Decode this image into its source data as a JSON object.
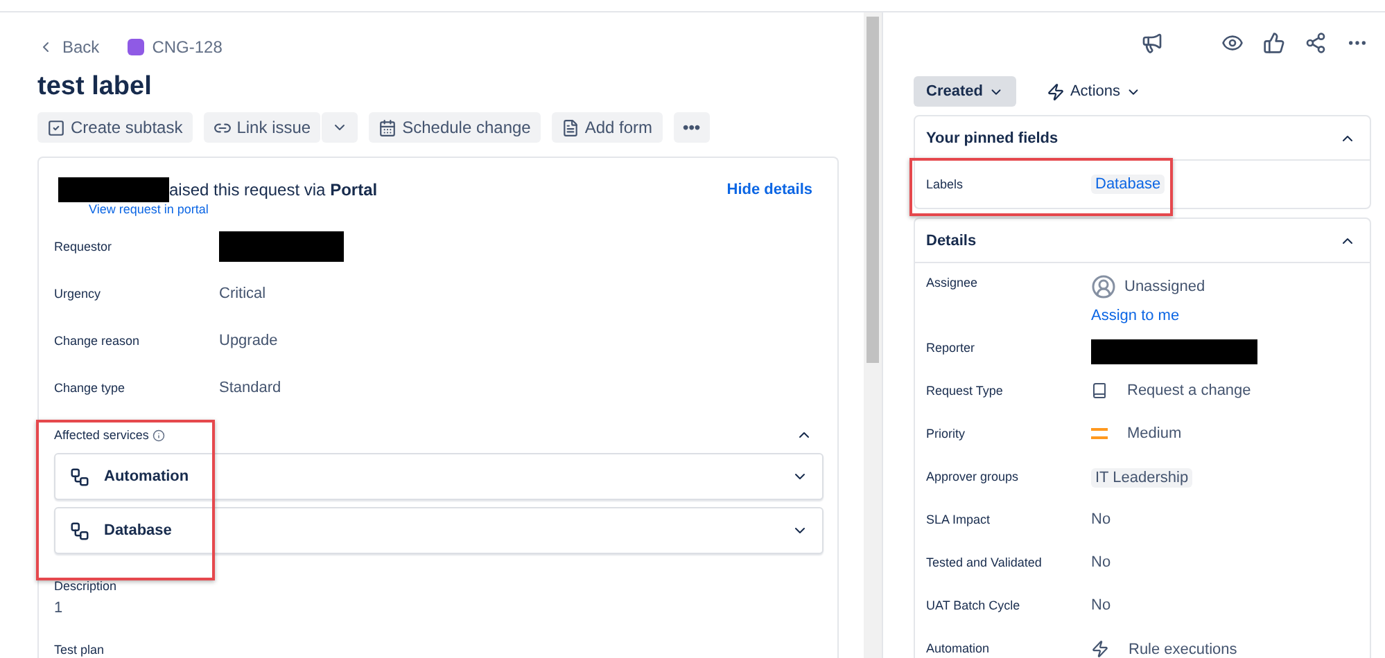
{
  "breadcrumb": {
    "back": "Back",
    "issue_key": "CNG-128"
  },
  "title": "test label",
  "toolbar": [
    {
      "kind": "subtask",
      "label": "Create subtask"
    },
    {
      "kind": "link",
      "label": "Link issue"
    },
    {
      "kind": "schedule",
      "label": "Schedule change"
    },
    {
      "kind": "form",
      "label": "Add form"
    },
    {
      "kind": "more",
      "label": "•••"
    }
  ],
  "request": {
    "raised_text": "aised this request via **Portal**",
    "view_link": "View request in portal",
    "hide_details": "Hide details",
    "redacted": true
  },
  "fields": [
    {
      "label": "Requestor",
      "kind": "redacted"
    },
    {
      "label": "Urgency",
      "kind": "text",
      "value": "Critical"
    },
    {
      "label": "Change reason",
      "kind": "text",
      "value": "Upgrade"
    },
    {
      "label": "Change type",
      "kind": "text",
      "value": "Standard"
    }
  ],
  "affected_services": {
    "label": "Affected services",
    "expanded": true,
    "highlighted": true,
    "items": [
      {
        "name": "Automation",
        "expanded": false
      },
      {
        "name": "Database",
        "expanded": false
      }
    ]
  },
  "description": {
    "label": "Description",
    "value": "1"
  },
  "next_label": "Test plan",
  "sidebar": {
    "status": "Created",
    "actions": "Actions",
    "pinned": {
      "title": "Your pinned fields",
      "expanded": true,
      "highlighted": true,
      "rows": [
        {
          "label": "Labels",
          "value": "Database"
        }
      ]
    },
    "details": {
      "title": "Details",
      "expanded": true,
      "rows": [
        {
          "label": "Assignee",
          "kind": "assignee",
          "value": "Unassigned",
          "link": "Assign to me"
        },
        {
          "label": "Reporter",
          "kind": "redacted"
        },
        {
          "label": "Request Type",
          "kind": "request-type",
          "value": "Request a change"
        },
        {
          "label": "Priority",
          "kind": "priority",
          "value": "Medium"
        },
        {
          "label": "Approver groups",
          "kind": "chip",
          "value": "IT Leadership"
        },
        {
          "label": "SLA Impact",
          "kind": "text",
          "value": "No"
        },
        {
          "label": "Tested and Validated",
          "kind": "text",
          "value": "No"
        },
        {
          "label": "UAT Batch Cycle",
          "kind": "text",
          "value": "No"
        },
        {
          "label": "Automation",
          "kind": "automation",
          "value": "Rule executions"
        }
      ]
    }
  }
}
